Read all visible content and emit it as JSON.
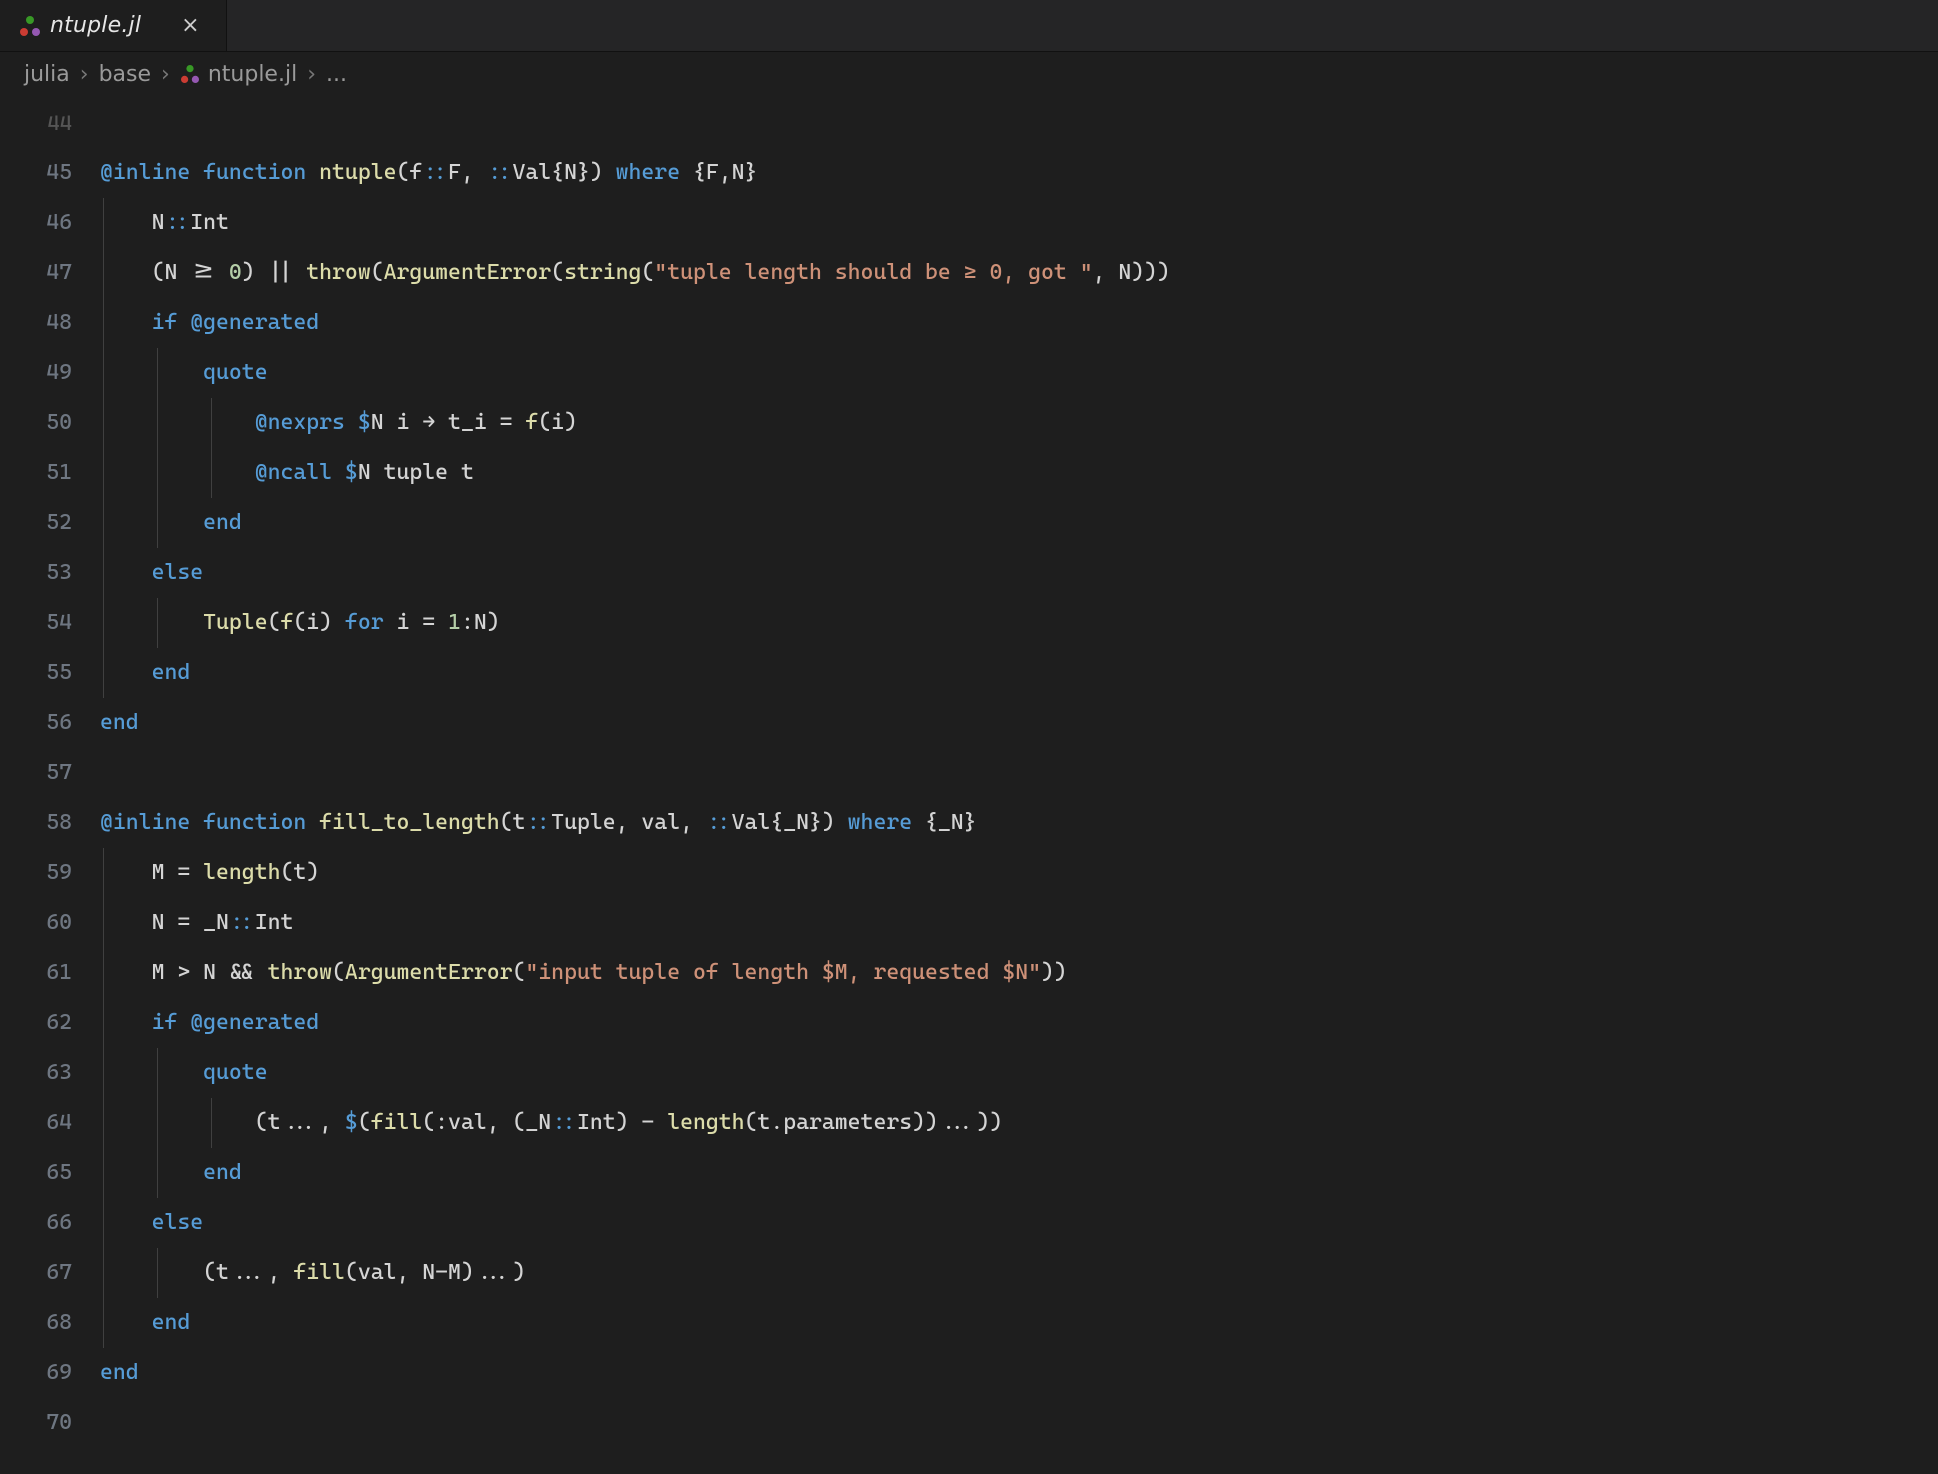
{
  "tab": {
    "title": "ntuple.jl",
    "icon": "julia-icon",
    "close_glyph": "×"
  },
  "breadcrumb": {
    "segments": [
      "julia",
      "base"
    ],
    "file": "ntuple.jl",
    "tail": "...",
    "sep": "›"
  },
  "gutter": {
    "first": 44,
    "last": 70,
    "faded_first": true
  },
  "code": [
    {
      "n": 44,
      "ind": 0,
      "guides": [],
      "tokens": []
    },
    {
      "n": 45,
      "ind": 0,
      "guides": [],
      "tokens": [
        [
          "blue",
          "@inline"
        ],
        [
          "default",
          " "
        ],
        [
          "blue",
          "function"
        ],
        [
          "default",
          " "
        ],
        [
          "yellow",
          "ntuple"
        ],
        [
          "default",
          "(f"
        ],
        [
          "blue",
          "::"
        ],
        [
          "default",
          "F, "
        ],
        [
          "blue",
          "::"
        ],
        [
          "default",
          "Val{N}) "
        ],
        [
          "blue",
          "where"
        ],
        [
          "default",
          " {F,N}"
        ]
      ]
    },
    {
      "n": 46,
      "ind": 1,
      "guides": [
        1
      ],
      "tokens": [
        [
          "default",
          "N"
        ],
        [
          "blue",
          "::"
        ],
        [
          "default",
          "Int"
        ]
      ]
    },
    {
      "n": 47,
      "ind": 1,
      "guides": [
        1
      ],
      "tokens": [
        [
          "default",
          "(N >= "
        ],
        [
          "green",
          "0"
        ],
        [
          "default",
          ") || "
        ],
        [
          "yellow",
          "throw"
        ],
        [
          "default",
          "("
        ],
        [
          "yellow",
          "ArgumentError"
        ],
        [
          "default",
          "("
        ],
        [
          "yellow",
          "string"
        ],
        [
          "default",
          "("
        ],
        [
          "orange",
          "\"tuple length should be ≥ 0, got \""
        ],
        [
          "default",
          ", N)))"
        ]
      ]
    },
    {
      "n": 48,
      "ind": 1,
      "guides": [
        1
      ],
      "tokens": [
        [
          "blue",
          "if"
        ],
        [
          "default",
          " "
        ],
        [
          "blue",
          "@generated"
        ]
      ]
    },
    {
      "n": 49,
      "ind": 2,
      "guides": [
        1,
        2
      ],
      "tokens": [
        [
          "blue",
          "quote"
        ]
      ]
    },
    {
      "n": 50,
      "ind": 3,
      "guides": [
        1,
        2,
        3
      ],
      "tokens": [
        [
          "blue",
          "@nexprs"
        ],
        [
          "default",
          " "
        ],
        [
          "blue",
          "$"
        ],
        [
          "default",
          "N i → t_i = "
        ],
        [
          "yellow",
          "f"
        ],
        [
          "default",
          "(i)"
        ]
      ]
    },
    {
      "n": 51,
      "ind": 3,
      "guides": [
        1,
        2,
        3
      ],
      "tokens": [
        [
          "blue",
          "@ncall"
        ],
        [
          "default",
          " "
        ],
        [
          "blue",
          "$"
        ],
        [
          "default",
          "N tuple t"
        ]
      ]
    },
    {
      "n": 52,
      "ind": 2,
      "guides": [
        1,
        2
      ],
      "tokens": [
        [
          "blue",
          "end"
        ]
      ]
    },
    {
      "n": 53,
      "ind": 1,
      "guides": [
        1
      ],
      "tokens": [
        [
          "blue",
          "else"
        ]
      ]
    },
    {
      "n": 54,
      "ind": 2,
      "guides": [
        1,
        2
      ],
      "tokens": [
        [
          "yellow",
          "Tuple"
        ],
        [
          "default",
          "("
        ],
        [
          "yellow",
          "f"
        ],
        [
          "default",
          "(i) "
        ],
        [
          "blue",
          "for"
        ],
        [
          "default",
          " i = "
        ],
        [
          "green",
          "1"
        ],
        [
          "default",
          ":N)"
        ]
      ]
    },
    {
      "n": 55,
      "ind": 1,
      "guides": [
        1
      ],
      "tokens": [
        [
          "blue",
          "end"
        ]
      ]
    },
    {
      "n": 56,
      "ind": 0,
      "guides": [],
      "tokens": [
        [
          "blue",
          "end"
        ]
      ]
    },
    {
      "n": 57,
      "ind": 0,
      "guides": [],
      "tokens": []
    },
    {
      "n": 58,
      "ind": 0,
      "guides": [],
      "tokens": [
        [
          "blue",
          "@inline"
        ],
        [
          "default",
          " "
        ],
        [
          "blue",
          "function"
        ],
        [
          "default",
          " "
        ],
        [
          "yellow",
          "fill_to_length"
        ],
        [
          "default",
          "(t"
        ],
        [
          "blue",
          "::"
        ],
        [
          "default",
          "Tuple, val, "
        ],
        [
          "blue",
          "::"
        ],
        [
          "default",
          "Val{_N}) "
        ],
        [
          "blue",
          "where"
        ],
        [
          "default",
          " {_N}"
        ]
      ]
    },
    {
      "n": 59,
      "ind": 1,
      "guides": [
        1
      ],
      "tokens": [
        [
          "default",
          "M = "
        ],
        [
          "yellow",
          "length"
        ],
        [
          "default",
          "(t)"
        ]
      ]
    },
    {
      "n": 60,
      "ind": 1,
      "guides": [
        1
      ],
      "tokens": [
        [
          "default",
          "N = _N"
        ],
        [
          "blue",
          "::"
        ],
        [
          "default",
          "Int"
        ]
      ]
    },
    {
      "n": 61,
      "ind": 1,
      "guides": [
        1
      ],
      "tokens": [
        [
          "default",
          "M > N && "
        ],
        [
          "yellow",
          "throw"
        ],
        [
          "default",
          "("
        ],
        [
          "yellow",
          "ArgumentError"
        ],
        [
          "default",
          "("
        ],
        [
          "orange",
          "\"input tuple of length $M, requested $N\""
        ],
        [
          "default",
          "))"
        ]
      ]
    },
    {
      "n": 62,
      "ind": 1,
      "guides": [
        1
      ],
      "tokens": [
        [
          "blue",
          "if"
        ],
        [
          "default",
          " "
        ],
        [
          "blue",
          "@generated"
        ]
      ]
    },
    {
      "n": 63,
      "ind": 2,
      "guides": [
        1,
        2
      ],
      "tokens": [
        [
          "blue",
          "quote"
        ]
      ]
    },
    {
      "n": 64,
      "ind": 3,
      "guides": [
        1,
        2,
        3
      ],
      "tokens": [
        [
          "default",
          "(t..., "
        ],
        [
          "blue",
          "$"
        ],
        [
          "default",
          "("
        ],
        [
          "yellow",
          "fill"
        ],
        [
          "default",
          "(:val, (_N"
        ],
        [
          "blue",
          "::"
        ],
        [
          "default",
          "Int) - "
        ],
        [
          "yellow",
          "length"
        ],
        [
          "default",
          "(t.parameters))...))"
        ]
      ]
    },
    {
      "n": 65,
      "ind": 2,
      "guides": [
        1,
        2
      ],
      "tokens": [
        [
          "blue",
          "end"
        ]
      ]
    },
    {
      "n": 66,
      "ind": 1,
      "guides": [
        1
      ],
      "tokens": [
        [
          "blue",
          "else"
        ]
      ]
    },
    {
      "n": 67,
      "ind": 2,
      "guides": [
        1,
        2
      ],
      "tokens": [
        [
          "default",
          "(t..., "
        ],
        [
          "yellow",
          "fill"
        ],
        [
          "default",
          "(val, N-M)...)"
        ]
      ]
    },
    {
      "n": 68,
      "ind": 1,
      "guides": [
        1
      ],
      "tokens": [
        [
          "blue",
          "end"
        ]
      ]
    },
    {
      "n": 69,
      "ind": 0,
      "guides": [],
      "tokens": [
        [
          "blue",
          "end"
        ]
      ]
    },
    {
      "n": 70,
      "ind": 0,
      "guides": [],
      "tokens": []
    }
  ],
  "indent_unit": "    "
}
